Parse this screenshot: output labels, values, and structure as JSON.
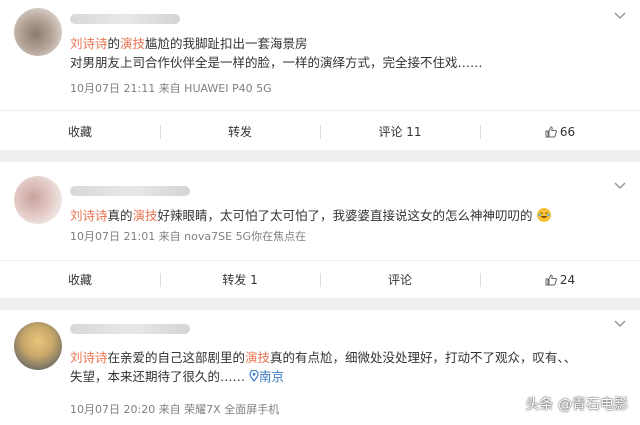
{
  "colors": {
    "highlight": "#eb7350",
    "meta": "#808080",
    "location": "#3a79c2",
    "background": "#eeeeee"
  },
  "comments": [
    {
      "name_obscured": true,
      "segments": [
        {
          "text": "刘诗诗",
          "highlight": true
        },
        {
          "text": "的",
          "highlight": false
        },
        {
          "text": "演技",
          "highlight": true
        },
        {
          "text": "尴尬的我脚趾扣出一套海景房",
          "highlight": false
        }
      ],
      "line2": "对男朋友上司合作伙伴全是一样的脸，一样的演绎方式，完全接不住戏……",
      "meta": "10月07日 21:11  来自 HUAWEI P40 5G",
      "actions": {
        "favorite": "收藏",
        "repost": "转发",
        "comment": "评论 11",
        "like": "66"
      }
    },
    {
      "name_obscured": true,
      "segments": [
        {
          "text": "刘诗诗",
          "highlight": true
        },
        {
          "text": "真的",
          "highlight": false
        },
        {
          "text": "演技",
          "highlight": true
        },
        {
          "text": "好辣眼睛，太可怕了太可怕了，我婆婆直接说这女的怎么神神叨叨的",
          "highlight": false
        }
      ],
      "emoji": "laugh-cry-emoji",
      "meta": "10月07日 21:01  来自 nova7SE 5G你在焦点在",
      "actions": {
        "favorite": "收藏",
        "repost": "转发 1",
        "comment": "评论",
        "like": "24"
      }
    },
    {
      "name_obscured": true,
      "segments": [
        {
          "text": "刘诗诗",
          "highlight": true
        },
        {
          "text": "在亲爱的自己这部剧里的",
          "highlight": false
        },
        {
          "text": "演技",
          "highlight": true
        },
        {
          "text": "真的有点尬，细微处没处理好，打动不了观众，叹有、、",
          "highlight": false
        }
      ],
      "line2": "失望，本来还期待了很久的……",
      "location": "南京",
      "meta": "10月07日 20:20  来自 荣耀7X 全面屏手机"
    }
  ],
  "watermark": "头条 @青石电影"
}
